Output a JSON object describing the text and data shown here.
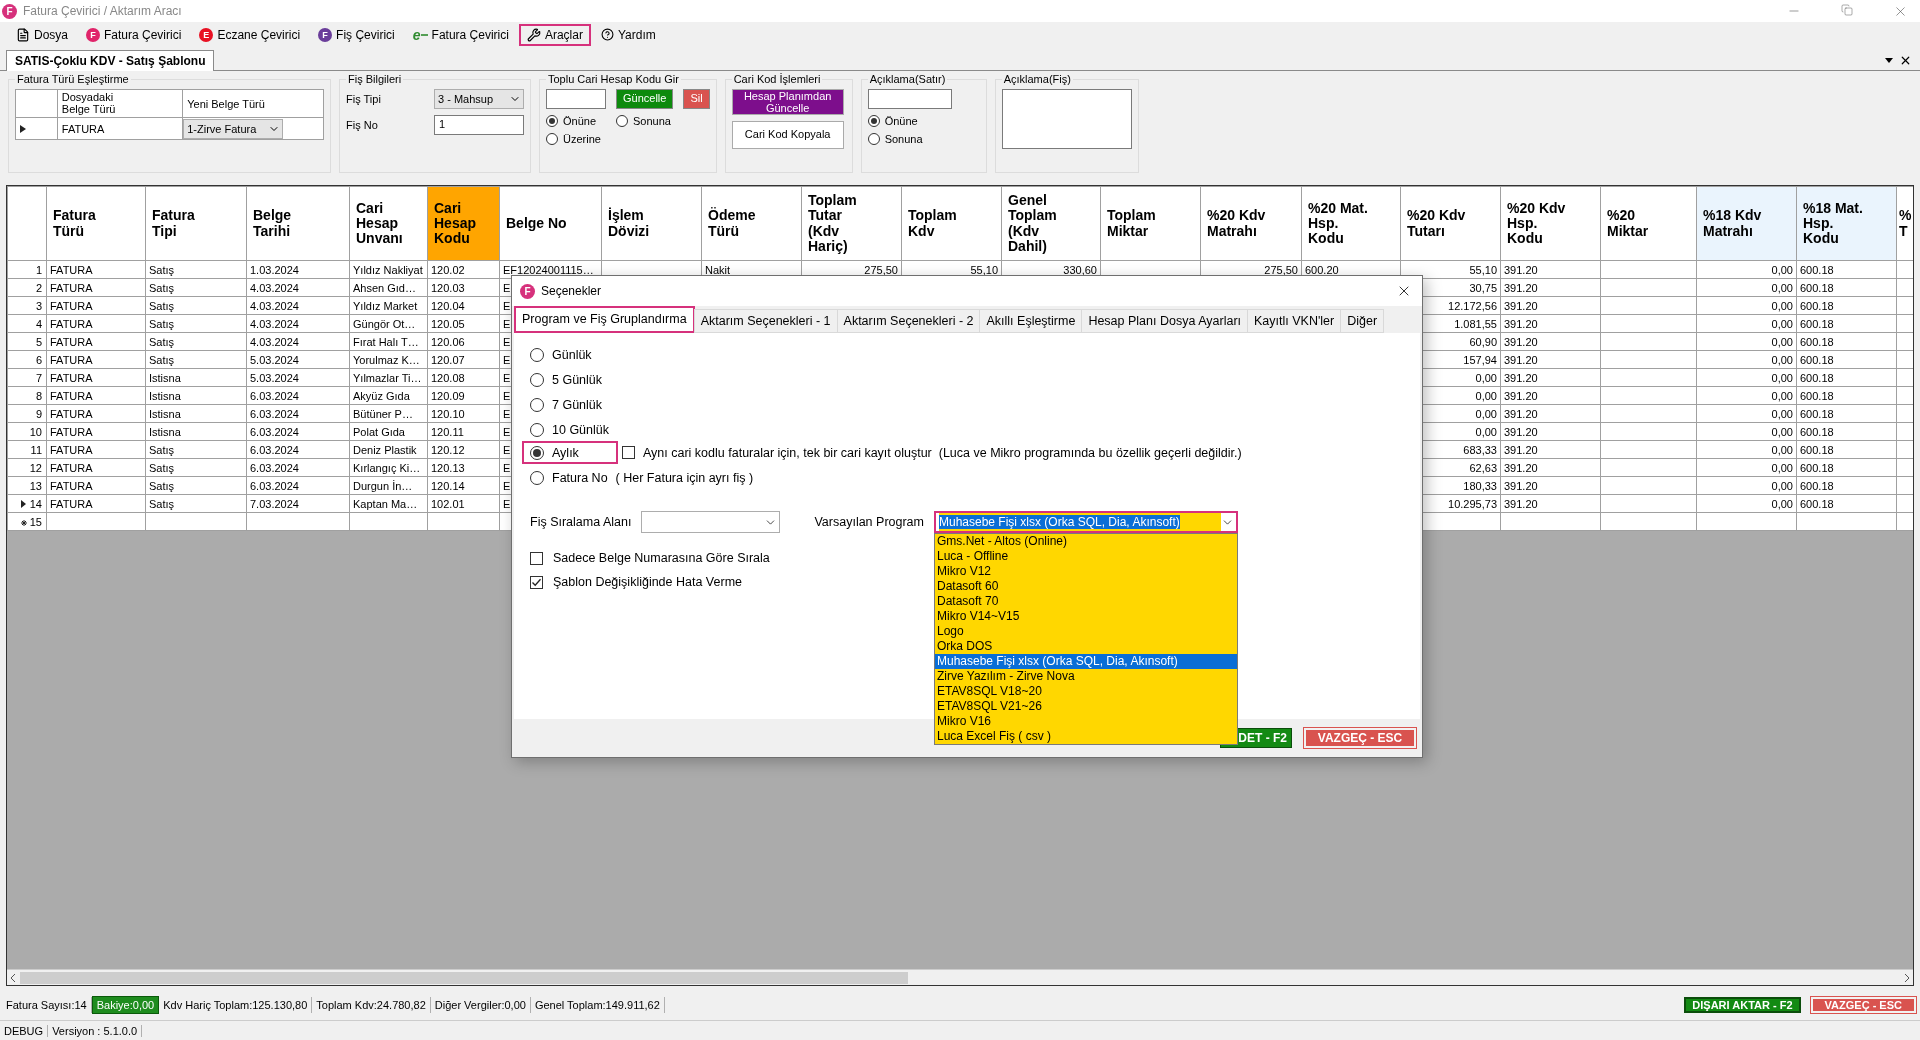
{
  "window": {
    "title": "Fatura Çevirici / Aktarım Aracı",
    "badge": "F"
  },
  "menu": [
    {
      "kind": "doc",
      "label": "Dosya",
      "highlighted": false
    },
    {
      "kind": "badge",
      "badge": "F",
      "color": "#e0246a",
      "label": "Fatura Çevirici",
      "highlighted": false
    },
    {
      "kind": "badge",
      "badge": "E",
      "color": "#e81123",
      "label": "Eczane Çevirici",
      "highlighted": false
    },
    {
      "kind": "badge",
      "badge": "F",
      "color": "#6a3d9a",
      "label": "Fiş Çevirici",
      "highlighted": false
    },
    {
      "kind": "efatura",
      "badge": "e",
      "label": "Fatura Çevirici",
      "highlighted": false
    },
    {
      "kind": "tools",
      "label": "Araçlar",
      "highlighted": true
    },
    {
      "kind": "help",
      "label": "Yardım",
      "highlighted": false
    }
  ],
  "document_tab": {
    "label": "SATIS-Çoklu KDV - Satış Şablonu"
  },
  "type_mapping": {
    "title": "Fatura Türü Eşleştirme",
    "columns": [
      "Dosyadaki\nBelge Türü",
      "Yeni Belge Türü"
    ],
    "rows": [
      {
        "source": "FATURA",
        "target": "1-Zirve Fatura"
      }
    ]
  },
  "voucher_info": {
    "title": "Fiş Bilgileri",
    "type_label": "Fiş Tipi",
    "type_value": "3 - Mahsup",
    "no_label": "Fiş No",
    "no_value": "1"
  },
  "bulk_code": {
    "title": "Toplu Cari Hesap Kodu Gir",
    "update_button": "Güncelle",
    "delete_button": "Sil",
    "options": [
      {
        "label": "Önüne",
        "selected": true
      },
      {
        "label": "Sonuna",
        "selected": false
      },
      {
        "label": "Üzerine",
        "selected": false
      }
    ]
  },
  "code_ops": {
    "title": "Cari Kod İşlemleri",
    "buttons": [
      {
        "label": "Hesap Planımdan\nGüncelle",
        "kind": "primary"
      },
      {
        "label": "Cari Kod Kopyala",
        "kind": "plain"
      }
    ]
  },
  "line_note": {
    "title": "Açıklama(Satır)",
    "options": [
      {
        "label": "Önüne",
        "selected": true
      },
      {
        "label": "Sonuna",
        "selected": false
      }
    ]
  },
  "voucher_note": {
    "title": "Açıklama(Fiş)"
  },
  "table": {
    "columns": [
      {
        "label": "Fatura\nTürü"
      },
      {
        "label": "Fatura\nTipi"
      },
      {
        "label": "Belge\nTarihi"
      },
      {
        "label": "Cari\nHesap\nUnvanı"
      },
      {
        "label": "Cari\nHesap\nKodu",
        "color": "#ffa500"
      },
      {
        "label": "Belge No"
      },
      {
        "label": "İşlem\nDövizi"
      },
      {
        "label": "Ödeme\nTürü"
      },
      {
        "label": "Toplam\nTutar\n(Kdv\nHariç)"
      },
      {
        "label": "Toplam\nKdv"
      },
      {
        "label": "Genel\nToplam\n(Kdv\nDahil)"
      },
      {
        "label": "Toplam\nMiktar"
      },
      {
        "label": "%20 Kdv\nMatrahı"
      },
      {
        "label": "%20 Mat.\nHsp.\nKodu"
      },
      {
        "label": "%20 Kdv\nTutarı"
      },
      {
        "label": "%20 Kdv\nHsp.\nKodu"
      },
      {
        "label": "%20\nMiktar"
      },
      {
        "label": "%18 Kdv\nMatrahı",
        "color": "#eaf4fd"
      },
      {
        "label": "%18 Mat.\nHsp.\nKodu",
        "color": "#eaf4fd"
      },
      {
        "label": "%\nT"
      }
    ],
    "rows": [
      {
        "number": "1",
        "current": false,
        "cells": [
          "FATURA",
          "Satış",
          "1.03.2024",
          "Yıldız Nakliyat",
          "120.02",
          "EF12024001115…",
          null,
          "Nakit",
          "275,50",
          "55,10",
          "330,60",
          null,
          "275,50",
          "600.20",
          "55,10",
          "391.20",
          null,
          "0,00",
          "600.18",
          null
        ]
      },
      {
        "number": "2",
        "current": false,
        "cells": [
          "FATURA",
          "Satış",
          "4.03.2024",
          "Ahsen Gıd…",
          "120.03",
          "E",
          null,
          null,
          null,
          null,
          null,
          null,
          null,
          null,
          "30,75",
          "391.20",
          null,
          "0,00",
          "600.18",
          null
        ]
      },
      {
        "number": "3",
        "current": false,
        "cells": [
          "FATURA",
          "Satış",
          "4.03.2024",
          "Yıldız Market",
          "120.04",
          "E",
          null,
          null,
          null,
          null,
          null,
          null,
          null,
          null,
          "12.172,56",
          "391.20",
          null,
          "0,00",
          "600.18",
          null
        ]
      },
      {
        "number": "4",
        "current": false,
        "cells": [
          "FATURA",
          "Satış",
          "4.03.2024",
          "Güngör Ot…",
          "120.05",
          "E",
          null,
          null,
          null,
          null,
          null,
          null,
          null,
          null,
          "1.081,55",
          "391.20",
          null,
          "0,00",
          "600.18",
          null
        ]
      },
      {
        "number": "5",
        "current": false,
        "cells": [
          "FATURA",
          "Satış",
          "4.03.2024",
          "Fırat Halı T…",
          "120.06",
          "E",
          null,
          null,
          null,
          null,
          null,
          null,
          null,
          null,
          "60,90",
          "391.20",
          null,
          "0,00",
          "600.18",
          null
        ]
      },
      {
        "number": "6",
        "current": false,
        "cells": [
          "FATURA",
          "Satış",
          "5.03.2024",
          "Yorulmaz K…",
          "120.07",
          "E",
          null,
          null,
          null,
          null,
          null,
          null,
          null,
          null,
          "157,94",
          "391.20",
          null,
          "0,00",
          "600.18",
          null
        ]
      },
      {
        "number": "7",
        "current": false,
        "cells": [
          "FATURA",
          "Istisna",
          "5.03.2024",
          "Yılmazlar Ti…",
          "120.08",
          "E",
          null,
          null,
          null,
          null,
          null,
          null,
          null,
          null,
          "0,00",
          "391.20",
          null,
          "0,00",
          "600.18",
          null
        ]
      },
      {
        "number": "8",
        "current": false,
        "cells": [
          "FATURA",
          "Istisna",
          "6.03.2024",
          "Akyüz Gıda",
          "120.09",
          "E",
          null,
          null,
          null,
          null,
          null,
          null,
          null,
          null,
          "0,00",
          "391.20",
          null,
          "0,00",
          "600.18",
          null
        ]
      },
      {
        "number": "9",
        "current": false,
        "cells": [
          "FATURA",
          "Istisna",
          "6.03.2024",
          "Bütüner P…",
          "120.10",
          "E",
          null,
          null,
          null,
          null,
          null,
          null,
          null,
          null,
          "0,00",
          "391.20",
          null,
          "0,00",
          "600.18",
          null
        ]
      },
      {
        "number": "10",
        "current": false,
        "cells": [
          "FATURA",
          "Istisna",
          "6.03.2024",
          "Polat Gıda",
          "120.11",
          "E",
          null,
          null,
          null,
          null,
          null,
          null,
          null,
          null,
          "0,00",
          "391.20",
          null,
          "0,00",
          "600.18",
          null
        ]
      },
      {
        "number": "11",
        "current": false,
        "cells": [
          "FATURA",
          "Satış",
          "6.03.2024",
          "Deniz Plastik",
          "120.12",
          "E",
          null,
          null,
          null,
          null,
          null,
          null,
          null,
          null,
          "683,33",
          "391.20",
          null,
          "0,00",
          "600.18",
          null
        ]
      },
      {
        "number": "12",
        "current": false,
        "cells": [
          "FATURA",
          "Satış",
          "6.03.2024",
          "Kırlangıç Ki…",
          "120.13",
          "E",
          null,
          null,
          null,
          null,
          null,
          null,
          null,
          null,
          "62,63",
          "391.20",
          null,
          "0,00",
          "600.18",
          null
        ]
      },
      {
        "number": "13",
        "current": false,
        "cells": [
          "FATURA",
          "Satış",
          "6.03.2024",
          "Durgun İn…",
          "120.14",
          "E",
          null,
          null,
          null,
          null,
          null,
          null,
          null,
          null,
          "180,33",
          "391.20",
          null,
          "0,00",
          "600.18",
          null
        ]
      },
      {
        "number": "14",
        "current": true,
        "cells": [
          "FATURA",
          "Satış",
          "7.03.2024",
          "Kaptan Ma…",
          "102.01",
          "E",
          null,
          null,
          null,
          null,
          null,
          null,
          null,
          null,
          "10.295,73",
          "391.20",
          null,
          "0,00",
          "600.18",
          null
        ]
      }
    ],
    "new_row": {
      "number": "15"
    }
  },
  "status_bar": {
    "items": [
      {
        "text": "Fatura Sayısı:14",
        "kind": "plain"
      },
      {
        "text": "Bakiye:0,00",
        "kind": "ok"
      },
      {
        "text": "Kdv Hariç Toplam:125.130,80",
        "kind": "plain"
      },
      {
        "text": "Toplam Kdv:24.780,82",
        "kind": "plain"
      },
      {
        "text": "Diğer Vergiler:0,00",
        "kind": "plain"
      },
      {
        "text": "Genel Toplam:149.911,62",
        "kind": "plain"
      }
    ],
    "buttons": [
      {
        "label": "DIŞARI AKTAR - F2",
        "kind": "confirm"
      },
      {
        "label": "VAZGEÇ - ESC",
        "kind": "cancel"
      }
    ]
  },
  "footer": [
    "DEBUG",
    "Versiyon : 5.1.0.0"
  ],
  "dialog": {
    "title": "Seçenekler",
    "badge": "F",
    "tabs": [
      {
        "label": "Program ve Fiş Gruplandırma",
        "selected": true,
        "highlighted": true
      },
      {
        "label": "Aktarım Seçenekleri - 1",
        "selected": false,
        "highlighted": false
      },
      {
        "label": "Aktarım Seçenekleri - 2",
        "selected": false,
        "highlighted": false
      },
      {
        "label": "Akıllı Eşleştirme",
        "selected": false,
        "highlighted": false
      },
      {
        "label": "Hesap Planı Dosya Ayarları",
        "selected": false,
        "highlighted": false
      },
      {
        "label": "Kayıtlı VKN'ler",
        "selected": false,
        "highlighted": false
      },
      {
        "label": "Diğer",
        "selected": false,
        "highlighted": false
      }
    ],
    "grouping": [
      {
        "label": "Günlük",
        "selected": false,
        "highlighted": false
      },
      {
        "label": "5 Günlük",
        "selected": false,
        "highlighted": false
      },
      {
        "label": "7 Günlük",
        "selected": false,
        "highlighted": false
      },
      {
        "label": "10 Günlük",
        "selected": false,
        "highlighted": false
      },
      {
        "label": "Aylık",
        "selected": true,
        "highlighted": true
      },
      {
        "label": "Fatura No",
        "note": "( Her Fatura için ayrı fiş )",
        "selected": false,
        "highlighted": false
      }
    ],
    "single_record": {
      "label": "Aynı cari kodlu faturalar için, tek bir cari kayıt oluştur  (Luca ve Mikro programında bu özellik geçerli değildir.)",
      "checked": false
    },
    "sort_field": {
      "label": "Fiş Sıralama Alanı"
    },
    "default_program": {
      "label": "Varsayılan Program",
      "value": "Muhasebe Fişi xlsx (Orka SQL, Dia, Akınsoft)",
      "highlighted": true,
      "expanded": true,
      "options": [
        {
          "label": "Gms.Net - Altos (Online)",
          "selected": false
        },
        {
          "label": "Luca - Offline",
          "selected": false
        },
        {
          "label": "Mikro V12",
          "selected": false
        },
        {
          "label": "Datasoft 60",
          "selected": false
        },
        {
          "label": "Datasoft 70",
          "selected": false
        },
        {
          "label": "Mikro V14~V15",
          "selected": false
        },
        {
          "label": "Logo",
          "selected": false
        },
        {
          "label": "Orka DOS",
          "selected": false
        },
        {
          "label": "Muhasebe Fişi xlsx (Orka SQL, Dia, Akınsoft)",
          "selected": true
        },
        {
          "label": "Zirve Yazılım - Zirve Nova",
          "selected": false
        },
        {
          "label": "ETAV8SQL V18~20",
          "selected": false
        },
        {
          "label": "ETAV8SQL V21~26",
          "selected": false
        },
        {
          "label": "Mikro V16",
          "selected": false
        },
        {
          "label": "Luca Excel Fiş ( csv )",
          "selected": false
        }
      ]
    },
    "checks": [
      {
        "label": "Sadece Belge Numarasına Göre Sırala",
        "checked": false
      },
      {
        "label": "Şablon Değişikliğinde Hata Verme",
        "checked": true
      }
    ],
    "buttons": [
      {
        "label": "DET - F2",
        "kind": "confirm"
      },
      {
        "label": "VAZGEÇ - ESC",
        "kind": "cancel"
      }
    ]
  }
}
